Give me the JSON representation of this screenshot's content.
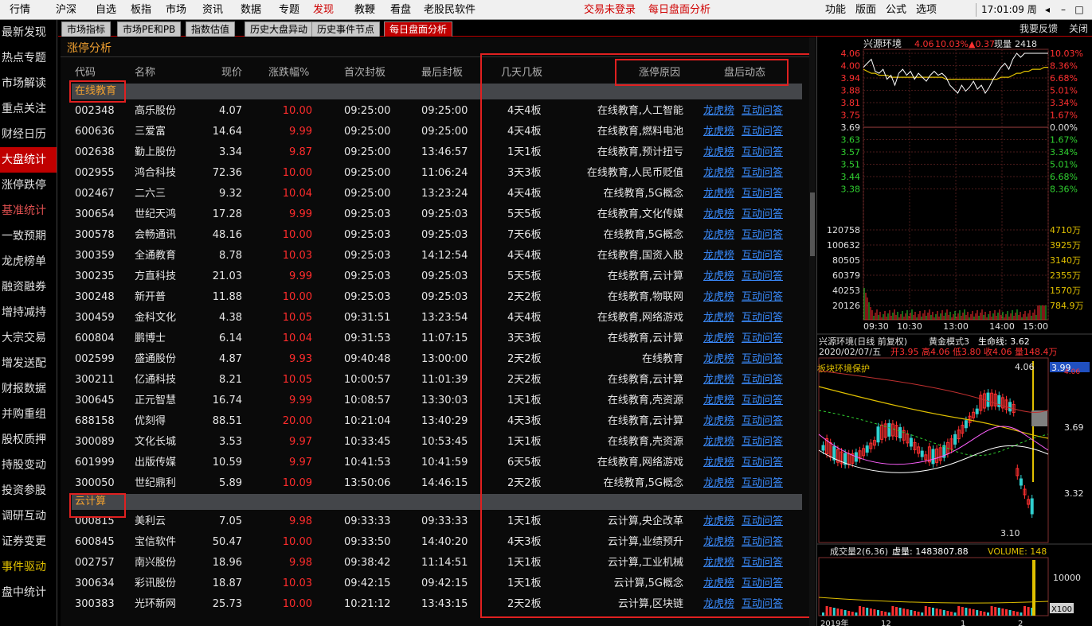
{
  "menu": {
    "items": [
      "行情",
      "沪深",
      "自选",
      "板指",
      "市场",
      "资讯",
      "数据",
      "专题",
      "发现",
      "教鞭",
      "看盘",
      "老股民软件"
    ],
    "active": "发现",
    "center": [
      "交易未登录",
      "每日盘面分析"
    ],
    "right": [
      "功能",
      "版面",
      "公式",
      "选项"
    ],
    "clock": "17:01:09",
    "clock_suffix": "周",
    "window_buttons": [
      "◂",
      "–",
      "□",
      "×"
    ]
  },
  "leftnav": [
    {
      "label": "最新发现",
      "style": ""
    },
    {
      "label": "热点专题",
      "style": ""
    },
    {
      "label": "市场解读",
      "style": ""
    },
    {
      "label": "重点关注",
      "style": ""
    },
    {
      "label": "财经日历",
      "style": ""
    },
    {
      "label": "大盘统计",
      "style": "active"
    },
    {
      "label": "涨停跌停",
      "style": ""
    },
    {
      "label": "基准统计",
      "style": "hl"
    },
    {
      "label": "一致预期",
      "style": ""
    },
    {
      "label": "龙虎榜单",
      "style": ""
    },
    {
      "label": "融资融券",
      "style": ""
    },
    {
      "label": "增持减持",
      "style": ""
    },
    {
      "label": "大宗交易",
      "style": ""
    },
    {
      "label": "增发送配",
      "style": ""
    },
    {
      "label": "财报数据",
      "style": ""
    },
    {
      "label": "并购重组",
      "style": ""
    },
    {
      "label": "股权质押",
      "style": ""
    },
    {
      "label": "持股变动",
      "style": ""
    },
    {
      "label": "投资参股",
      "style": ""
    },
    {
      "label": "调研互动",
      "style": ""
    },
    {
      "label": "证券变更",
      "style": ""
    },
    {
      "label": "事件驱动",
      "style": "yl"
    },
    {
      "label": "盘中统计",
      "style": ""
    }
  ],
  "tabs": [
    {
      "label": "市场指标",
      "active": false
    },
    {
      "label": "市场PE和PB",
      "active": false
    },
    {
      "label": "指数估值",
      "active": false
    },
    {
      "label": "历史大盘异动",
      "active": false
    },
    {
      "label": "历史事件节点",
      "active": false
    },
    {
      "label": "每日盘面分析",
      "active": true
    }
  ],
  "tab_links": [
    "我要反馈",
    "关闭"
  ],
  "panel_title": "涨停分析",
  "columns": {
    "code": "代码",
    "name": "名称",
    "price": "现价",
    "pct": "涨跌幅%",
    "first": "首次封板",
    "last": "最后封板",
    "days": "几天几板",
    "reason": "涨停原因",
    "after": "盘后动态"
  },
  "link_labels": {
    "lhb": "龙虎榜",
    "qa": "互动问答"
  },
  "groups": [
    {
      "name": "在线教育",
      "rows": [
        [
          "002348",
          "高乐股份",
          "4.07",
          "10.00",
          "09:25:00",
          "09:25:00",
          "4天4板",
          "在线教育,人工智能"
        ],
        [
          "600636",
          "三爱富",
          "14.64",
          "9.99",
          "09:25:00",
          "09:25:00",
          "4天4板",
          "在线教育,燃料电池"
        ],
        [
          "002638",
          "勤上股份",
          "3.34",
          "9.87",
          "09:25:00",
          "13:46:57",
          "1天1板",
          "在线教育,预计扭亏"
        ],
        [
          "002955",
          "鸿合科技",
          "72.36",
          "10.00",
          "09:25:00",
          "11:06:24",
          "3天3板",
          "在线教育,人民币贬值"
        ],
        [
          "002467",
          "二六三",
          "9.32",
          "10.04",
          "09:25:00",
          "13:23:24",
          "4天4板",
          "在线教育,5G概念"
        ],
        [
          "300654",
          "世纪天鸿",
          "17.28",
          "9.99",
          "09:25:03",
          "09:25:03",
          "5天5板",
          "在线教育,文化传媒"
        ],
        [
          "300578",
          "会畅通讯",
          "48.16",
          "10.00",
          "09:25:03",
          "09:25:03",
          "7天6板",
          "在线教育,5G概念"
        ],
        [
          "300359",
          "全通教育",
          "8.78",
          "10.03",
          "09:25:03",
          "14:12:54",
          "4天4板",
          "在线教育,国资入股"
        ],
        [
          "300235",
          "方直科技",
          "21.03",
          "9.99",
          "09:25:03",
          "09:25:03",
          "5天5板",
          "在线教育,云计算"
        ],
        [
          "300248",
          "新开普",
          "11.88",
          "10.00",
          "09:25:03",
          "09:25:03",
          "2天2板",
          "在线教育,物联网"
        ],
        [
          "300459",
          "金科文化",
          "4.38",
          "10.05",
          "09:31:51",
          "13:23:54",
          "4天4板",
          "在线教育,网络游戏"
        ],
        [
          "600804",
          "鹏博士",
          "6.14",
          "10.04",
          "09:31:53",
          "11:07:15",
          "3天3板",
          "在线教育,云计算"
        ],
        [
          "002599",
          "盛通股份",
          "4.87",
          "9.93",
          "09:40:48",
          "13:00:00",
          "2天2板",
          "在线教育"
        ],
        [
          "300211",
          "亿通科技",
          "8.21",
          "10.05",
          "10:00:57",
          "11:01:39",
          "2天2板",
          "在线教育,云计算"
        ],
        [
          "300645",
          "正元智慧",
          "16.74",
          "9.99",
          "10:08:57",
          "13:30:03",
          "1天1板",
          "在线教育,壳资源"
        ],
        [
          "688158",
          "优刻得",
          "88.51",
          "20.00",
          "10:21:04",
          "13:40:29",
          "4天3板",
          "在线教育,云计算"
        ],
        [
          "300089",
          "文化长城",
          "3.53",
          "9.97",
          "10:33:45",
          "10:53:45",
          "1天1板",
          "在线教育,壳资源"
        ],
        [
          "601999",
          "出版传媒",
          "10.59",
          "9.97",
          "10:41:53",
          "10:41:59",
          "6天5板",
          "在线教育,网络游戏"
        ],
        [
          "300050",
          "世纪鼎利",
          "5.89",
          "10.09",
          "13:50:06",
          "14:46:15",
          "2天2板",
          "在线教育,5G概念"
        ]
      ]
    },
    {
      "name": "云计算",
      "rows": [
        [
          "000815",
          "美利云",
          "7.05",
          "9.98",
          "09:33:33",
          "09:33:33",
          "1天1板",
          "云计算,央企改革"
        ],
        [
          "600845",
          "宝信软件",
          "50.47",
          "10.00",
          "09:33:50",
          "14:40:20",
          "4天3板",
          "云计算,业绩预升"
        ],
        [
          "002757",
          "南兴股份",
          "18.96",
          "9.98",
          "09:38:42",
          "11:14:51",
          "1天1板",
          "云计算,工业机械"
        ],
        [
          "300634",
          "彩讯股份",
          "18.87",
          "10.03",
          "09:42:15",
          "09:42:15",
          "1天1板",
          "云计算,5G概念"
        ],
        [
          "300383",
          "光环新网",
          "25.73",
          "10.00",
          "10:21:12",
          "13:43:15",
          "2天2板",
          "云计算,区块链"
        ]
      ]
    }
  ],
  "intraday": {
    "stock": "兴源环境",
    "price": "4.06",
    "pct": "10.03%",
    "change": "▲0.37",
    "vol_label": "现量",
    "vol": "2418",
    "left_ticks": [
      "4.06",
      "4.00",
      "3.94",
      "3.88",
      "3.81",
      "3.75",
      "3.69",
      "3.63",
      "3.57",
      "3.51",
      "3.44",
      "3.38"
    ],
    "right_ticks": [
      "10.03%",
      "8.36%",
      "6.68%",
      "5.01%",
      "3.34%",
      "1.67%",
      "0.00%",
      "1.67%",
      "3.34%",
      "5.01%",
      "6.68%",
      "8.36%"
    ],
    "vol_ticks_left": [
      "120758",
      "100632",
      "80505",
      "60379",
      "40253",
      "20126"
    ],
    "vol_ticks_right": [
      "4710万",
      "3925万",
      "3140万",
      "2355万",
      "1570万",
      "784.9万"
    ],
    "time_ticks": [
      "09:30",
      "10:30",
      "13:00",
      "14:00",
      "15:00"
    ],
    "price_series": [
      3.99,
      4.01,
      4.03,
      3.97,
      3.96,
      3.98,
      3.93,
      3.95,
      3.9,
      3.96,
      3.98,
      3.95,
      3.97,
      3.93,
      3.96,
      3.94,
      3.92,
      3.95,
      3.97,
      3.95,
      3.96,
      3.94,
      3.9,
      3.88,
      3.86,
      3.9,
      3.87,
      3.89,
      3.92,
      3.88,
      3.9,
      3.86,
      3.89,
      3.93,
      3.96,
      3.99,
      4.01,
      3.98,
      4.03,
      4.06,
      4.04,
      4.06,
      4.06,
      4.06,
      4.06,
      4.06,
      4.06,
      4.06
    ],
    "avg_series": [
      3.98,
      3.97,
      3.96,
      3.96,
      3.95,
      3.95,
      3.95,
      3.94,
      3.94,
      3.94,
      3.94,
      3.94,
      3.94,
      3.94,
      3.94,
      3.94,
      3.94,
      3.94,
      3.94,
      3.94,
      3.94,
      3.93,
      3.93,
      3.93,
      3.93,
      3.93,
      3.93,
      3.93,
      3.93,
      3.93,
      3.93,
      3.93,
      3.93,
      3.93,
      3.93,
      3.94,
      3.94,
      3.94,
      3.95,
      3.96,
      3.96,
      3.97,
      3.97,
      3.98,
      3.98,
      3.98,
      3.99,
      3.99
    ]
  },
  "kline": {
    "title": "兴源环境(日线 前复权)",
    "indicator": "黄金模式3",
    "life_line": "生命线: 3.62",
    "date": "2020/02/07/五",
    "ohlc": "开3.95 高4.06 低3.80 收4.06 量148.4万",
    "overlay_text": "板块环境保护",
    "high_label": "4.06",
    "low_label": "3.10",
    "price_tag": "3.99",
    "right_ticks": [
      "4.06",
      "3.69",
      "3.32"
    ],
    "dates": [
      "2019年",
      "12",
      "1",
      "2"
    ]
  },
  "volume": {
    "title": "成交量2(6,36)",
    "vol_text": "虚量: 1483807.88",
    "volume_label": "VOLUME: 148",
    "tick": "10000",
    "unit": "X100"
  }
}
